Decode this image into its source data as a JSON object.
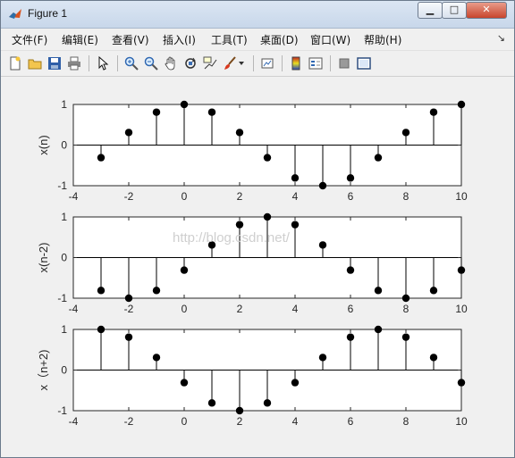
{
  "window": {
    "title": "Figure 1",
    "min_label": "▁",
    "max_label": "□",
    "close_label": "✕"
  },
  "menu": {
    "items": [
      "文件(F)",
      "编辑(E)",
      "查看(V)",
      "插入(I)",
      "工具(T)",
      "桌面(D)",
      "窗口(W)",
      "帮助(H)"
    ],
    "overflow_arrow": "↘"
  },
  "toolbar": {
    "icons": [
      "new-figure-icon",
      "open-icon",
      "save-icon",
      "print-icon",
      "pointer-icon",
      "zoom-in-icon",
      "zoom-out-icon",
      "pan-icon",
      "rotate-3d-icon",
      "data-cursor-icon",
      "brush-icon",
      "dropdown-arrow-icon",
      "link-plot-icon",
      "colorbar-icon",
      "legend-icon",
      "hide-plot-tools-icon",
      "show-plot-tools-icon"
    ]
  },
  "watermark": "http://blog.csdn.net/",
  "chart_data": [
    {
      "type": "stem",
      "ylabel": "x(n)",
      "xlim": [
        -4,
        10
      ],
      "ylim": [
        -1,
        1
      ],
      "xticks": [
        "-4",
        "-2",
        "0",
        "2",
        "4",
        "6",
        "8",
        "10"
      ],
      "yticks": [
        "-1",
        "0",
        "1"
      ],
      "x": [
        -3,
        -2,
        -1,
        0,
        1,
        2,
        3,
        4,
        5,
        6,
        7,
        8,
        9,
        10
      ],
      "values": [
        -0.31,
        0.31,
        0.81,
        1.0,
        0.81,
        0.31,
        -0.31,
        -0.81,
        -1.0,
        -0.81,
        -0.31,
        0.31,
        0.81,
        1.0
      ]
    },
    {
      "type": "stem",
      "ylabel": "x(n-2)",
      "xlim": [
        -4,
        10
      ],
      "ylim": [
        -1,
        1
      ],
      "xticks": [
        "-4",
        "-2",
        "0",
        "2",
        "4",
        "6",
        "8",
        "10"
      ],
      "yticks": [
        "-1",
        "0",
        "1"
      ],
      "x": [
        -3,
        -2,
        -1,
        0,
        1,
        2,
        3,
        4,
        5,
        6,
        7,
        8,
        9,
        10
      ],
      "values": [
        -0.81,
        -1.0,
        -0.81,
        -0.31,
        0.31,
        0.81,
        1.0,
        0.81,
        0.31,
        -0.31,
        -0.81,
        -1.0,
        -0.81,
        -0.31
      ]
    },
    {
      "type": "stem",
      "ylabel": "x（n+2)",
      "xlim": [
        -4,
        10
      ],
      "ylim": [
        -1,
        1
      ],
      "xticks": [
        "-4",
        "-2",
        "0",
        "2",
        "4",
        "6",
        "8",
        "10"
      ],
      "yticks": [
        "-1",
        "0",
        "1"
      ],
      "x": [
        -3,
        -2,
        -1,
        0,
        1,
        2,
        3,
        4,
        5,
        6,
        7,
        8,
        9,
        10
      ],
      "values": [
        1.0,
        0.81,
        0.31,
        -0.31,
        -0.81,
        -1.0,
        -0.81,
        -0.31,
        0.31,
        0.81,
        1.0,
        0.81,
        0.31,
        -0.31
      ]
    }
  ]
}
